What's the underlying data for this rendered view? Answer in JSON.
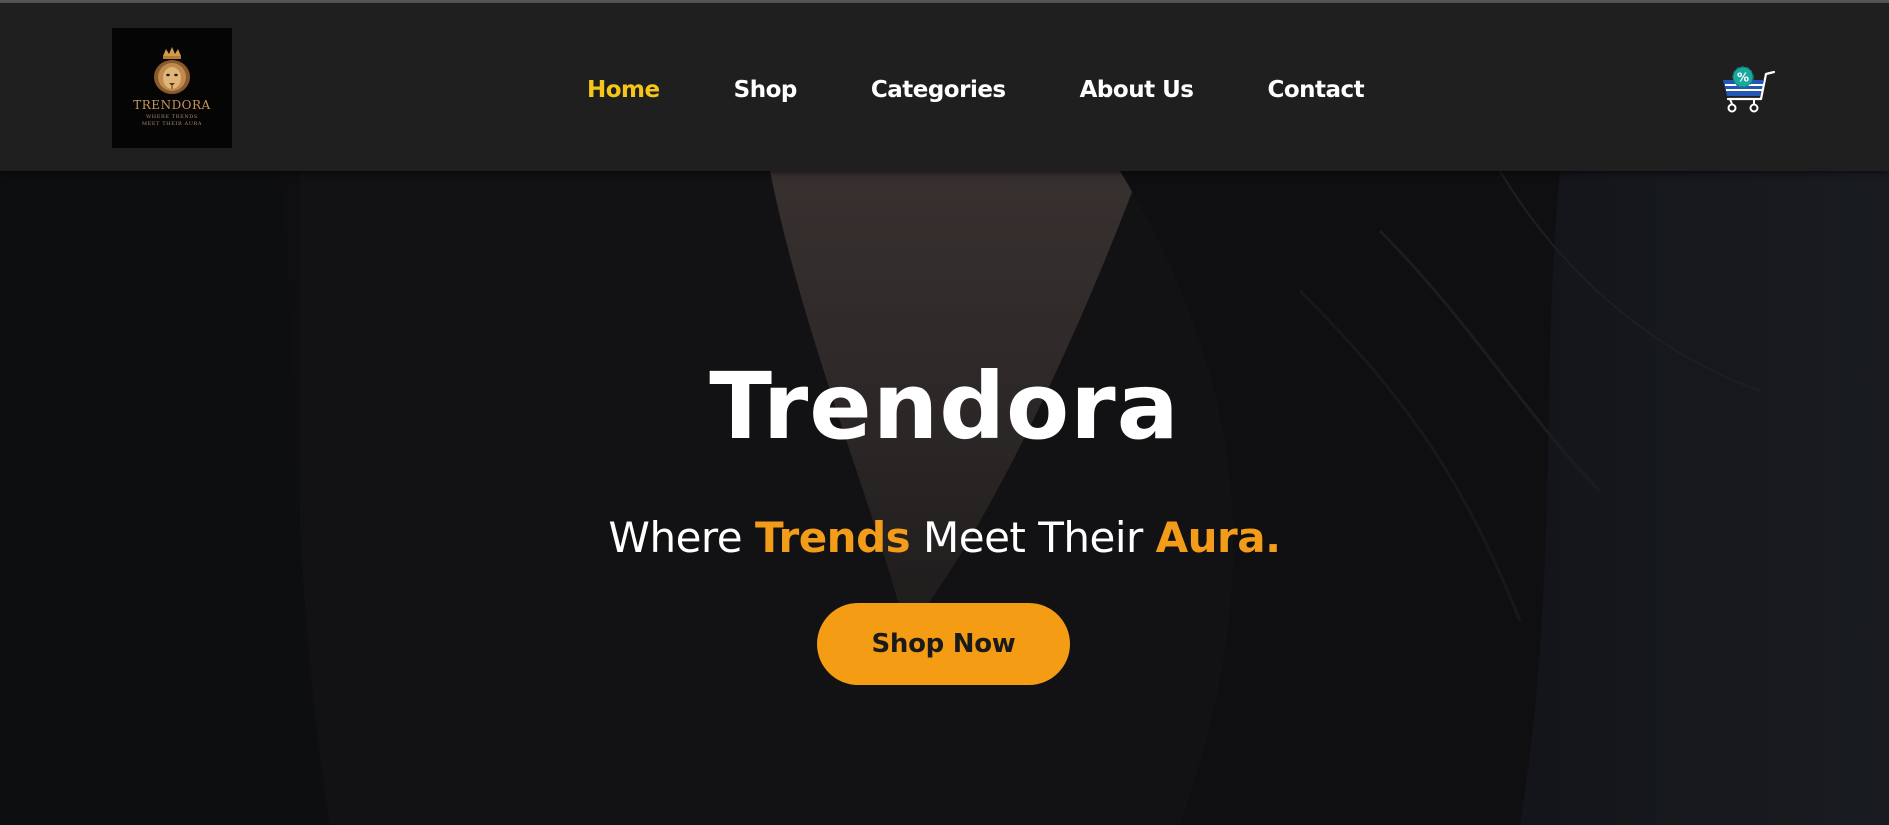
{
  "brand": {
    "logo_name": "TRENDORA",
    "logo_tagline": "WHERE TRENDS MEET THEIR AURA",
    "logo_color": "#c8955b"
  },
  "nav": {
    "items": [
      {
        "label": "Home",
        "active": true
      },
      {
        "label": "Shop",
        "active": false
      },
      {
        "label": "Categories",
        "active": false
      },
      {
        "label": "About Us",
        "active": false
      },
      {
        "label": "Contact",
        "active": false
      }
    ],
    "active_color": "#f5c518"
  },
  "cart": {
    "icon": "shopping-cart-discount-icon",
    "badge_symbol": "%"
  },
  "hero": {
    "title": "Trendora",
    "subtitle": {
      "part1": "Where ",
      "highlight1": "Trends",
      "part2": " Meet Their ",
      "highlight2": "Aura."
    },
    "accent_color": "#f39c1a",
    "cta_label": "Shop Now"
  }
}
